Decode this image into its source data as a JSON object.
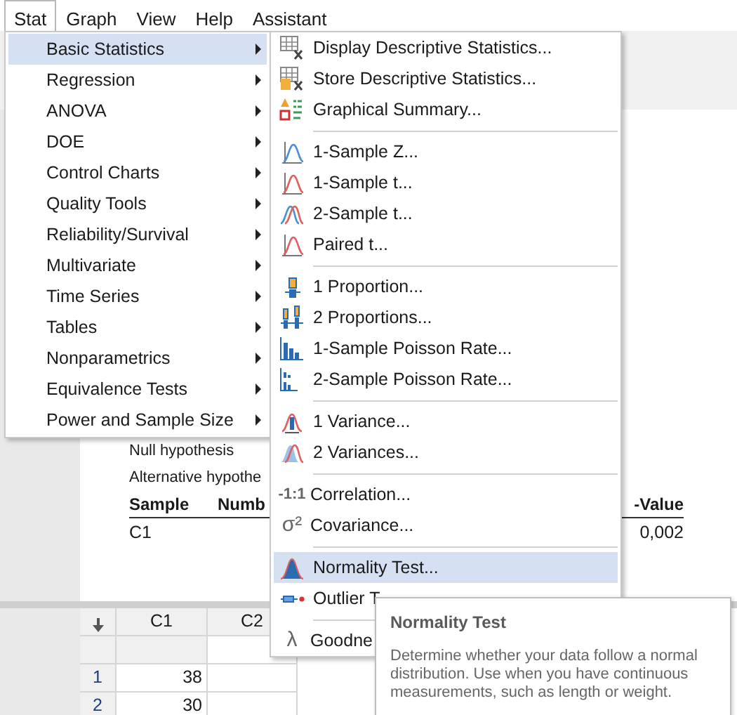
{
  "menubar": [
    {
      "label": "Stat",
      "selected": true
    },
    {
      "label": "Graph",
      "selected": false
    },
    {
      "label": "View",
      "selected": false
    },
    {
      "label": "Help",
      "selected": false
    },
    {
      "label": "Assistant",
      "selected": false
    }
  ],
  "stat_menu": [
    {
      "label": "Basic Statistics",
      "selected": true,
      "has_submenu": true
    },
    {
      "label": "Regression",
      "selected": false,
      "has_submenu": true
    },
    {
      "label": "ANOVA",
      "selected": false,
      "has_submenu": true
    },
    {
      "label": "DOE",
      "selected": false,
      "has_submenu": true
    },
    {
      "label": "Control Charts",
      "selected": false,
      "has_submenu": true
    },
    {
      "label": "Quality Tools",
      "selected": false,
      "has_submenu": true
    },
    {
      "label": "Reliability/Survival",
      "selected": false,
      "has_submenu": true
    },
    {
      "label": "Multivariate",
      "selected": false,
      "has_submenu": true
    },
    {
      "label": "Time Series",
      "selected": false,
      "has_submenu": true
    },
    {
      "label": "Tables",
      "selected": false,
      "has_submenu": true
    },
    {
      "label": "Nonparametrics",
      "selected": false,
      "has_submenu": true
    },
    {
      "label": "Equivalence Tests",
      "selected": false,
      "has_submenu": true
    },
    {
      "label": "Power and Sample Size",
      "selected": false,
      "has_submenu": true
    }
  ],
  "basic_statistics_menu": {
    "groups": [
      [
        {
          "label": "Display Descriptive Statistics...",
          "selected": false
        },
        {
          "label": "Store Descriptive Statistics...",
          "selected": false
        },
        {
          "label": "Graphical Summary...",
          "selected": false
        }
      ],
      [
        {
          "label": "1-Sample Z...",
          "selected": false
        },
        {
          "label": "1-Sample t...",
          "selected": false
        },
        {
          "label": "2-Sample t...",
          "selected": false
        },
        {
          "label": "Paired t...",
          "selected": false
        }
      ],
      [
        {
          "label": "1 Proportion...",
          "selected": false
        },
        {
          "label": "2 Proportions...",
          "selected": false
        },
        {
          "label": "1-Sample Poisson Rate...",
          "selected": false
        },
        {
          "label": "2-Sample Poisson Rate...",
          "selected": false
        }
      ],
      [
        {
          "label": "1 Variance...",
          "selected": false
        },
        {
          "label": "2 Variances...",
          "selected": false
        }
      ],
      [
        {
          "label": "Correlation...",
          "selected": false,
          "glyph": "-1:1"
        },
        {
          "label": "Covariance...",
          "selected": false,
          "glyph": "σ²"
        }
      ],
      [
        {
          "label": "Normality Test...",
          "selected": true
        },
        {
          "label": "Outlier T",
          "selected": false
        }
      ],
      [
        {
          "label": "Goodne",
          "selected": false,
          "glyph": "λ"
        }
      ]
    ]
  },
  "output": {
    "lines": [
      "Null hypothesis",
      "Alternative hypothe"
    ],
    "columns": {
      "sample": "Sample",
      "number": "Numb",
      "p_value": "-Value"
    },
    "rows": [
      {
        "sample": "C1",
        "p_value": "0,002"
      }
    ]
  },
  "worksheet": {
    "columns": [
      "C1",
      "C2"
    ],
    "rows": [
      {
        "number": "1",
        "c1": "38"
      },
      {
        "number": "2",
        "c1": "30"
      }
    ]
  },
  "tooltip": {
    "title": "Normality Test",
    "text": "Determine whether your data follow a normal distribution. Use when you have continuous measurements, such as length or weight."
  }
}
